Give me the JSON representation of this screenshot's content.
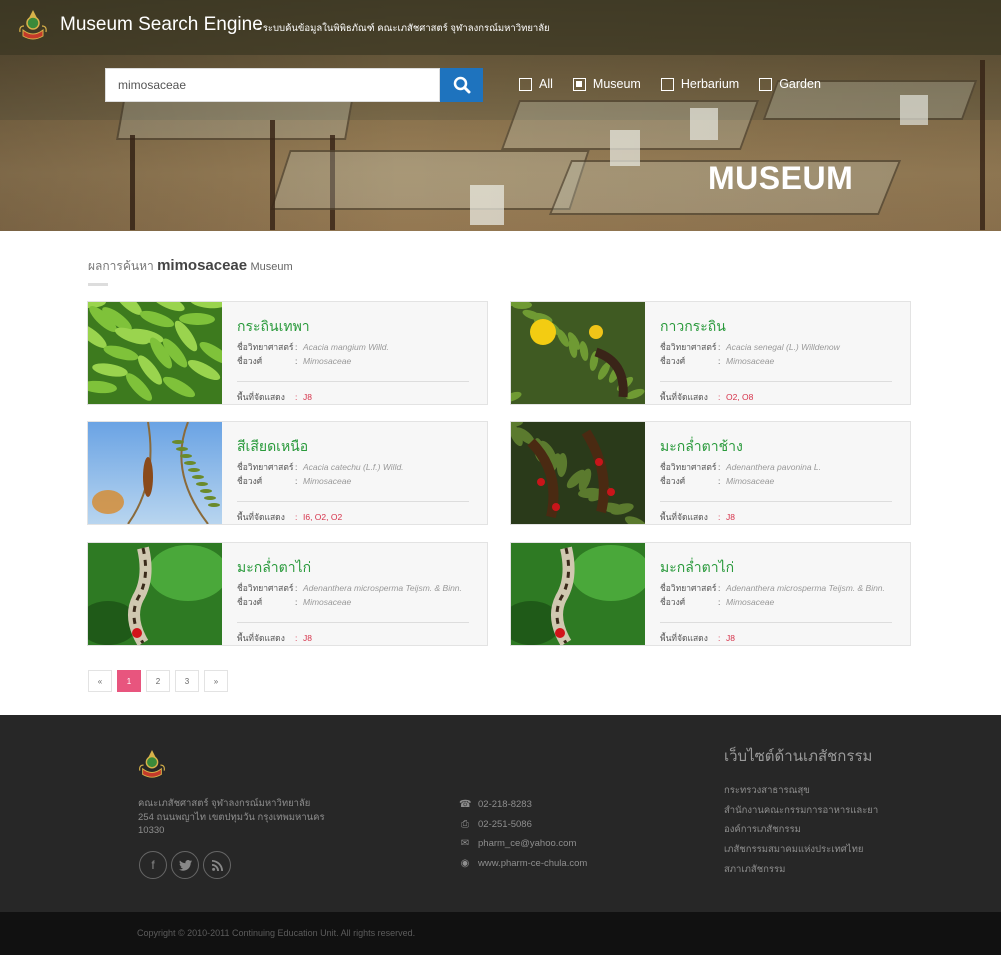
{
  "header": {
    "brand_title": "Museum Search Engine",
    "brand_subtitle": "- ระบบค้นข้อมูลในพิพิธภัณฑ์ คณะเภสัชศาสตร์ จุฬาลงกรณ์มหาวิทยาลัย",
    "hero_title": "MUSEUM"
  },
  "search": {
    "value": "mimosaceae",
    "placeholder": ""
  },
  "filters": [
    {
      "label": "All",
      "checked": false
    },
    {
      "label": "Museum",
      "checked": true
    },
    {
      "label": "Herbarium",
      "checked": false
    },
    {
      "label": "Garden",
      "checked": false
    }
  ],
  "results": {
    "prefix": "ผลการค้นหา",
    "keyword": "mimosaceae",
    "section": "Museum",
    "labels": {
      "scientific": "ชื่อวิทยาศาสตร์",
      "family": "ชื่อวงศ์",
      "location": "พื้นที่จัดแสดง",
      "colon": ":"
    },
    "items": [
      {
        "name": "กระถินเทพา",
        "scientific": "Acacia mangium Willd.",
        "family": "Mimosaceae",
        "location": "J8"
      },
      {
        "name": "กาวกระถิน",
        "scientific": "Acacia senegal (L.) Willdenow",
        "family": "Mimosaceae",
        "location": "O2, O8"
      },
      {
        "name": "สีเสียดเหนือ",
        "scientific": "Acacia catechu (L.f.) Willd.",
        "family": "Mimosaceae",
        "location": "I6, O2, O2"
      },
      {
        "name": "มะกล่ำตาช้าง",
        "scientific": "Adenanthera pavonina L.",
        "family": "Mimosaceae",
        "location": "J8"
      },
      {
        "name": "มะกล่ำตาไก่",
        "scientific": "Adenanthera microsperma Teijsm. & Binn.",
        "family": "Mimosaceae",
        "location": "J8"
      },
      {
        "name": "มะกล่ำตาไก่",
        "scientific": "Adenanthera microsperma Teijsm. & Binn.",
        "family": "Mimosaceae",
        "location": "J8"
      }
    ]
  },
  "pagination": {
    "prev": "«",
    "pages": [
      "1",
      "2",
      "3"
    ],
    "current": "1",
    "next": "»"
  },
  "footer": {
    "address_line1": "คณะเภสัชศาสตร์ จุฬาลงกรณ์มหาวิทยาลัย",
    "address_line2": "254 ถนนพญาไท เขตปทุมวัน กรุงเทพมหานคร",
    "address_line3": "10330",
    "social": [
      "f",
      "t",
      "rss"
    ],
    "phone": "02-218-8283",
    "fax": "02-251-5086",
    "email": "pharm_ce@yahoo.com",
    "website": "www.pharm-ce-chula.com",
    "links_title": "เว็บไซต์ด้านเภสัชกรรม",
    "links": [
      "กระทรวงสาธารณสุข",
      "สำนักงานคณะกรรมการอาหารและยา",
      "องค์การเภสัชกรรม",
      "เภสัชกรรมสมาคมแห่งประเทศไทย",
      "สภาเภสัชกรรม"
    ],
    "copyright": "Copyright © 2010-2011 Continuing Education Unit. All rights reserved."
  },
  "colors": {
    "accent_blue": "#1e73be",
    "name_green": "#2a9a3c",
    "location_red": "#d6334b",
    "page_active": "#e8557e",
    "footer_bg": "#272727"
  }
}
